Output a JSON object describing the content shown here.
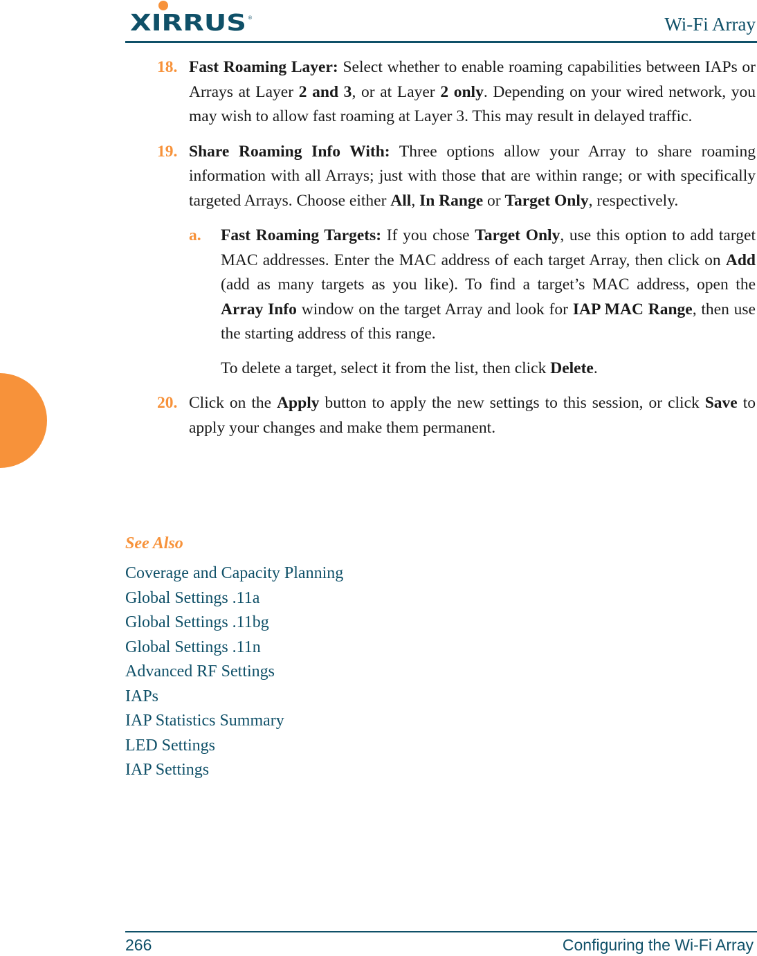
{
  "header": {
    "logo_text": "XIRRUS",
    "title": "Wi-Fi Array",
    "colors": {
      "brand": "#0f5068",
      "accent": "#f7923a"
    }
  },
  "steps": [
    {
      "num": "18.",
      "parts": [
        {
          "b": "Fast Roaming Layer:"
        },
        {
          "t": " Select whether to enable roaming capabilities between IAPs or Arrays at Layer "
        },
        {
          "b": "2 and 3"
        },
        {
          "t": ", or at Layer "
        },
        {
          "b": "2 only"
        },
        {
          "t": ". Depending on your wired network, you may wish to allow fast roaming at Layer 3. This may result in delayed traffic."
        }
      ]
    },
    {
      "num": "19.",
      "parts": [
        {
          "b": "Share Roaming Info With:"
        },
        {
          "t": " Three options allow your Array to share roaming information with all Arrays; just with those that are within range; or with specifically targeted Arrays. Choose either "
        },
        {
          "b": "All"
        },
        {
          "t": ", "
        },
        {
          "b": "In Range"
        },
        {
          "t": " or "
        },
        {
          "b": "Target Only"
        },
        {
          "t": ", respectively."
        }
      ],
      "sub": {
        "letter": "a.",
        "parts": [
          {
            "b": "Fast Roaming Targets:"
          },
          {
            "t": " If you chose "
          },
          {
            "b": "Target Only"
          },
          {
            "t": ", use this option to add target MAC addresses. Enter the MAC address of each target Array, then click on "
          },
          {
            "b": "Add"
          },
          {
            "t": " (add as many targets as you like). To find a target’s MAC address, open the "
          },
          {
            "b": "Array Info"
          },
          {
            "t": " window on the target Array and look for "
          },
          {
            "b": "IAP MAC Range"
          },
          {
            "t": ", then use the starting address of this range."
          }
        ],
        "extra": [
          {
            "t": "To delete a target, select it from the list, then click "
          },
          {
            "b": "Delete"
          },
          {
            "t": "."
          }
        ]
      }
    },
    {
      "num": "20.",
      "parts": [
        {
          "t": "Click on the "
        },
        {
          "b": "Apply"
        },
        {
          "t": " button to apply the new settings to this session, or click "
        },
        {
          "b": "Save"
        },
        {
          "t": " to apply your changes and make them permanent."
        }
      ]
    }
  ],
  "see_also": {
    "heading": "See Also",
    "links": [
      "Coverage and Capacity Planning",
      "Global Settings .11a",
      "Global Settings .11bg",
      "Global Settings .11n",
      "Advanced RF Settings",
      "IAPs",
      "IAP Statistics Summary",
      "LED Settings",
      "IAP Settings"
    ]
  },
  "footer": {
    "page_number": "266",
    "chapter_title": "Configuring the Wi-Fi Array"
  }
}
